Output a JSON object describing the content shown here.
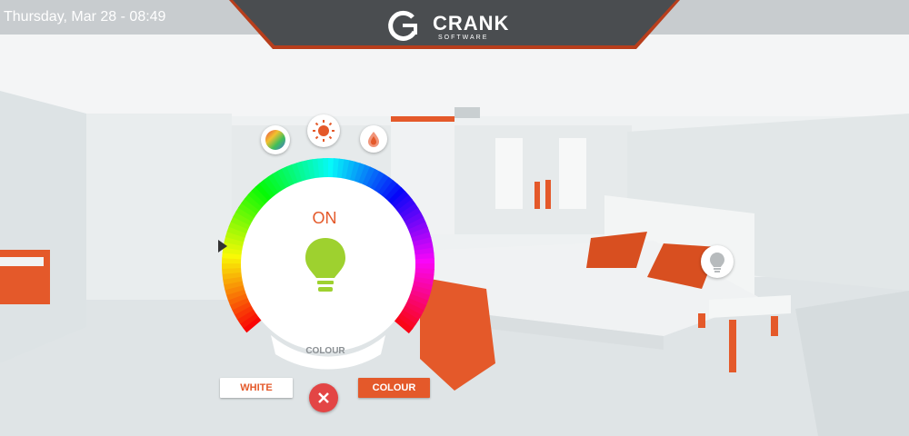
{
  "header": {
    "datetime": "Thursday, Mar 28 - 08:49",
    "brand": "CRANK",
    "brand_sub": "SOFTWARE"
  },
  "light_control": {
    "status": "ON",
    "mode_label": "COLOUR",
    "bulb_color": "#9ed12f",
    "modes": [
      "colour-wheel-icon",
      "brightness-icon",
      "temperature-icon"
    ]
  },
  "buttons": {
    "white": "WHITE",
    "colour": "COLOUR"
  },
  "colors": {
    "accent": "#e4592a",
    "close": "#e34545",
    "topbar": "#c8cccf",
    "logo_bg": "#4a4d50"
  }
}
